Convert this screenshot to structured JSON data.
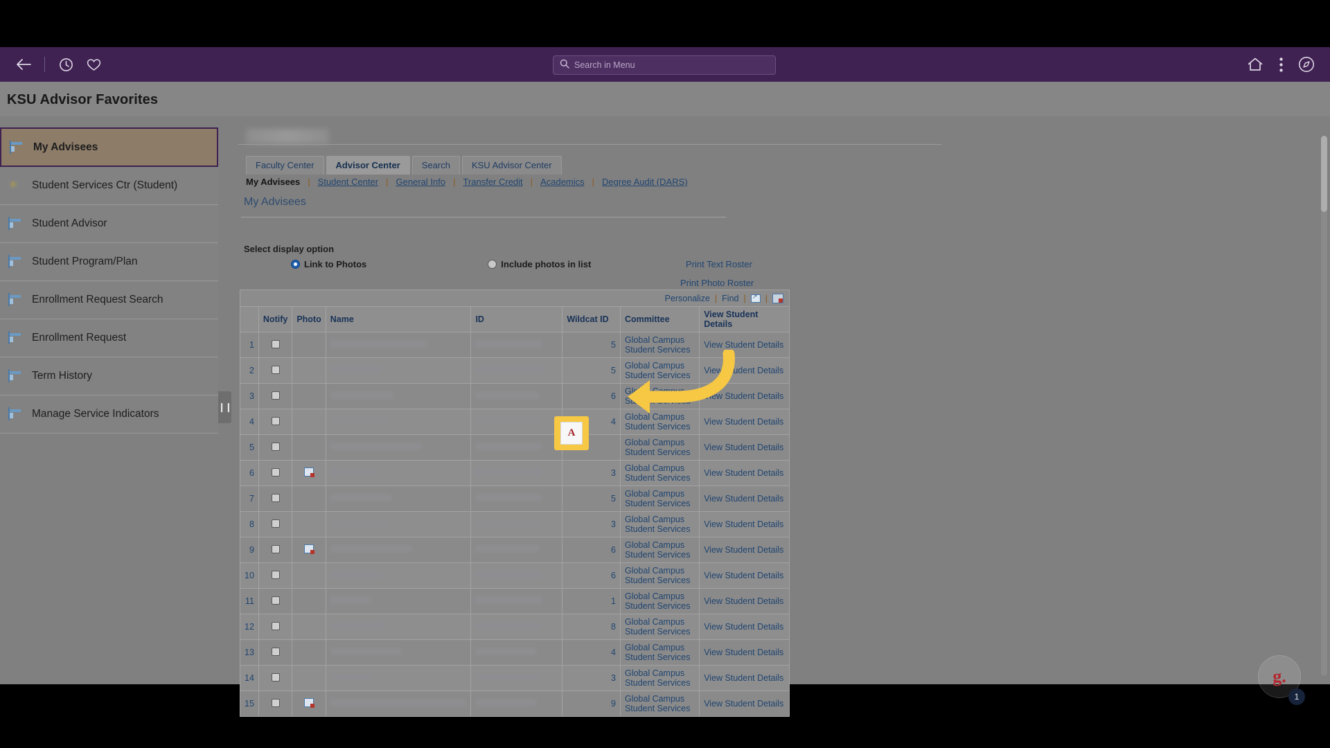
{
  "browser": {
    "back_icon": "back-arrow-icon",
    "history_icon": "clock-icon",
    "favorites_icon": "heart-icon",
    "home_icon": "home-icon",
    "actions_icon": "kebab-menu-icon",
    "nav_icon": "compass-icon"
  },
  "search": {
    "placeholder": "Search in Menu",
    "value": ""
  },
  "header": {
    "title": "KSU Advisor Favorites"
  },
  "sidebar": {
    "items": [
      {
        "label": "My Advisees",
        "icon": "window-icon",
        "active": true
      },
      {
        "label": "Student Services Ctr (Student)",
        "icon": "atom-icon",
        "active": false
      },
      {
        "label": "Student Advisor",
        "icon": "window-icon",
        "active": false
      },
      {
        "label": "Student Program/Plan",
        "icon": "window-icon",
        "active": false
      },
      {
        "label": "Enrollment Request Search",
        "icon": "window-icon",
        "active": false
      },
      {
        "label": "Enrollment Request",
        "icon": "window-icon",
        "active": false
      },
      {
        "label": "Term History",
        "icon": "window-icon",
        "active": false
      },
      {
        "label": "Manage Service Indicators",
        "icon": "window-icon",
        "active": false
      }
    ],
    "collapse_handle": "❙❙"
  },
  "tabs": [
    {
      "label": "Faculty Center",
      "accesskey": "F",
      "active": false
    },
    {
      "label": "Advisor Center",
      "accesskey": "",
      "active": true
    },
    {
      "label": "Search",
      "accesskey": "h",
      "active": false
    },
    {
      "label": "KSU Advisor Center",
      "accesskey": "",
      "active": false
    }
  ],
  "subnav": [
    {
      "label": "My Advisees",
      "current": true
    },
    {
      "label": "Student Center",
      "current": false
    },
    {
      "label": "General Info",
      "current": false
    },
    {
      "label": "Transfer Credit",
      "current": false
    },
    {
      "label": "Academics",
      "current": false
    },
    {
      "label": "Degree Audit (DARS)",
      "current": false
    }
  ],
  "section": {
    "title": "My Advisees"
  },
  "display_options": {
    "label": "Select display option",
    "options": [
      {
        "label": "Link to Photos",
        "selected": true
      },
      {
        "label": "Include photos in list",
        "selected": false
      }
    ]
  },
  "links": {
    "print_text_roster": "Print Text Roster",
    "print_photo_roster": "Print Photo Roster"
  },
  "grid_toolbar": {
    "personalize": "Personalize",
    "find": "Find",
    "popout_icon": "popout-window-icon",
    "download_icon": "download-spreadsheet-icon"
  },
  "table": {
    "columns": [
      "",
      "Notify",
      "Photo",
      "Name",
      "ID",
      "Wildcat ID",
      "Committee",
      "View Student Details"
    ],
    "view_details_label": "View Student Details",
    "committee_label": "Global Campus Student Services",
    "rows": [
      {
        "n": "1",
        "name": "",
        "id": "",
        "wildcat": "5",
        "photo": false,
        "name_w": 140,
        "id_w": 96
      },
      {
        "n": "2",
        "name": "",
        "id": "",
        "wildcat": "5",
        "photo": false,
        "name_w": 74,
        "id_w": 100
      },
      {
        "n": "3",
        "name": "",
        "id": "",
        "wildcat": "6",
        "photo": false,
        "name_w": 92,
        "id_w": 92
      },
      {
        "n": "4",
        "name": "",
        "id": "",
        "wildcat": "4",
        "photo": false,
        "name_w": 84,
        "id_w": 96
      },
      {
        "n": "5",
        "name": "",
        "id": "",
        "wildcat": "",
        "photo": false,
        "name_w": 132,
        "id_w": 96
      },
      {
        "n": "6",
        "name": "",
        "id": "",
        "wildcat": "3",
        "photo": true,
        "name_w": 66,
        "id_w": 96
      },
      {
        "n": "7",
        "name": "",
        "id": "",
        "wildcat": "5",
        "photo": false,
        "name_w": 88,
        "id_w": 96
      },
      {
        "n": "8",
        "name": "",
        "id": "",
        "wildcat": "3",
        "photo": false,
        "name_w": 84,
        "id_w": 96
      },
      {
        "n": "9",
        "name": "",
        "id": "",
        "wildcat": "6",
        "photo": true,
        "name_w": 118,
        "id_w": 92
      },
      {
        "n": "10",
        "name": "",
        "id": "",
        "wildcat": "6",
        "photo": false,
        "name_w": 76,
        "id_w": 96
      },
      {
        "n": "11",
        "name": "",
        "id": "",
        "wildcat": "1",
        "photo": false,
        "name_w": 60,
        "id_w": 96
      },
      {
        "n": "12",
        "name": "",
        "id": "",
        "wildcat": "8",
        "photo": false,
        "name_w": 78,
        "id_w": 96
      },
      {
        "n": "13",
        "name": "",
        "id": "",
        "wildcat": "4",
        "photo": false,
        "name_w": 104,
        "id_w": 88
      },
      {
        "n": "14",
        "name": "",
        "id": "",
        "wildcat": "3",
        "photo": false,
        "name_w": 62,
        "id_w": 96
      },
      {
        "n": "15",
        "name": "",
        "id": "",
        "wildcat": "9",
        "photo": true,
        "name_w": 196,
        "id_w": 88
      }
    ]
  },
  "annotation": {
    "highlight_icon_letter": "A",
    "highlight_icon_name": "letter-a-icon",
    "arrow_color": "#f7c843"
  },
  "helper_widget": {
    "logo": "g.",
    "badge": "1"
  },
  "colors": {
    "brand_purple": "#3f2152",
    "link_blue": "#1f4470",
    "highlight_yellow": "#f7c843",
    "active_item": "#8d7c68"
  }
}
